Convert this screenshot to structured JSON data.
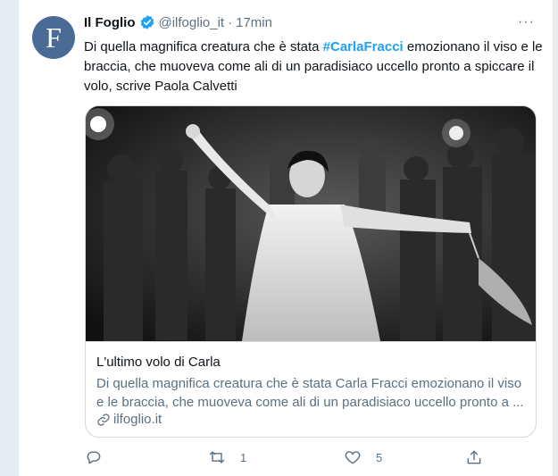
{
  "account": {
    "name": "Il Foglio",
    "handle": "@ilfoglio_it",
    "separator": "·",
    "time": "17min",
    "avatar_letter": "F"
  },
  "tweet": {
    "text_before": "Di quella magnifica creatura che è stata ",
    "hashtag": "#CarlaFracci",
    "text_after": " emozionano il viso e le braccia, che muoveva come ali di un paradisiaco uccello pronto a spiccare il volo, scrive Paola Calvetti"
  },
  "card": {
    "title": "L'ultimo volo di Carla",
    "description": "Di quella magnifica creatura che è stata Carla Fracci emozionano il viso e le braccia, che muoveva come ali di un paradisiaco uccello pronto a ...",
    "domain": "ilfoglio.it"
  },
  "actions": {
    "reply_count": "",
    "retweet_count": "1",
    "like_count": "5"
  },
  "colors": {
    "accent": "#1da1f2",
    "muted": "#5b7083"
  }
}
